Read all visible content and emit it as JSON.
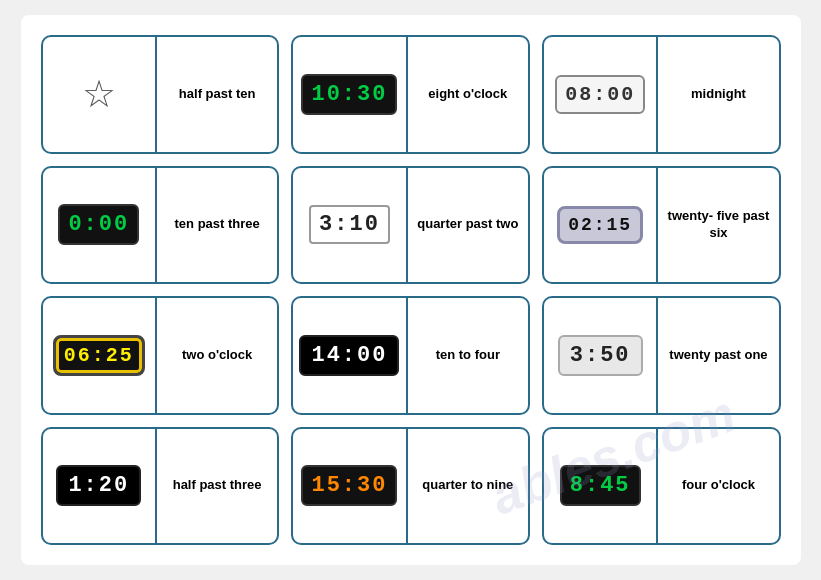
{
  "cards": [
    {
      "id": "card-1",
      "clock_type": "star",
      "clock_display": "★",
      "time_label": "half past\nten"
    },
    {
      "id": "card-2",
      "clock_type": "seg-dark",
      "clock_display": "10:30",
      "time_label": "eight\no'clock"
    },
    {
      "id": "card-3",
      "clock_type": "seg-gray",
      "clock_display": "08:00",
      "time_label": "midnight"
    },
    {
      "id": "card-4",
      "clock_type": "seg-dark",
      "clock_display": "0:00",
      "time_label": "ten past\nthree"
    },
    {
      "id": "card-5",
      "clock_type": "seg-white",
      "clock_display": "3:10",
      "time_label": "quarter\npast two"
    },
    {
      "id": "card-6",
      "clock_type": "seg-bluegray",
      "clock_display": "02:15",
      "time_label": "twenty-\nfive past\nsix"
    },
    {
      "id": "card-7",
      "clock_type": "seg-color",
      "clock_display": "06:25",
      "time_label": "two\no'clock"
    },
    {
      "id": "card-8",
      "clock_type": "seg-black",
      "clock_display": "14:00",
      "time_label": "ten to\nfour"
    },
    {
      "id": "card-9",
      "clock_type": "seg-light",
      "clock_display": "3:50",
      "time_label": "twenty\npast one"
    },
    {
      "id": "card-10",
      "clock_type": "seg-black",
      "clock_display": "1:20",
      "time_label": "half past\nthree"
    },
    {
      "id": "card-11",
      "clock_type": "seg-amber",
      "clock_display": "15:30",
      "time_label": "quarter\nto nine"
    },
    {
      "id": "card-12",
      "clock_type": "seg-dark2",
      "clock_display": "8:45",
      "time_label": "four\no'clock"
    }
  ],
  "watermark": "ables.com"
}
